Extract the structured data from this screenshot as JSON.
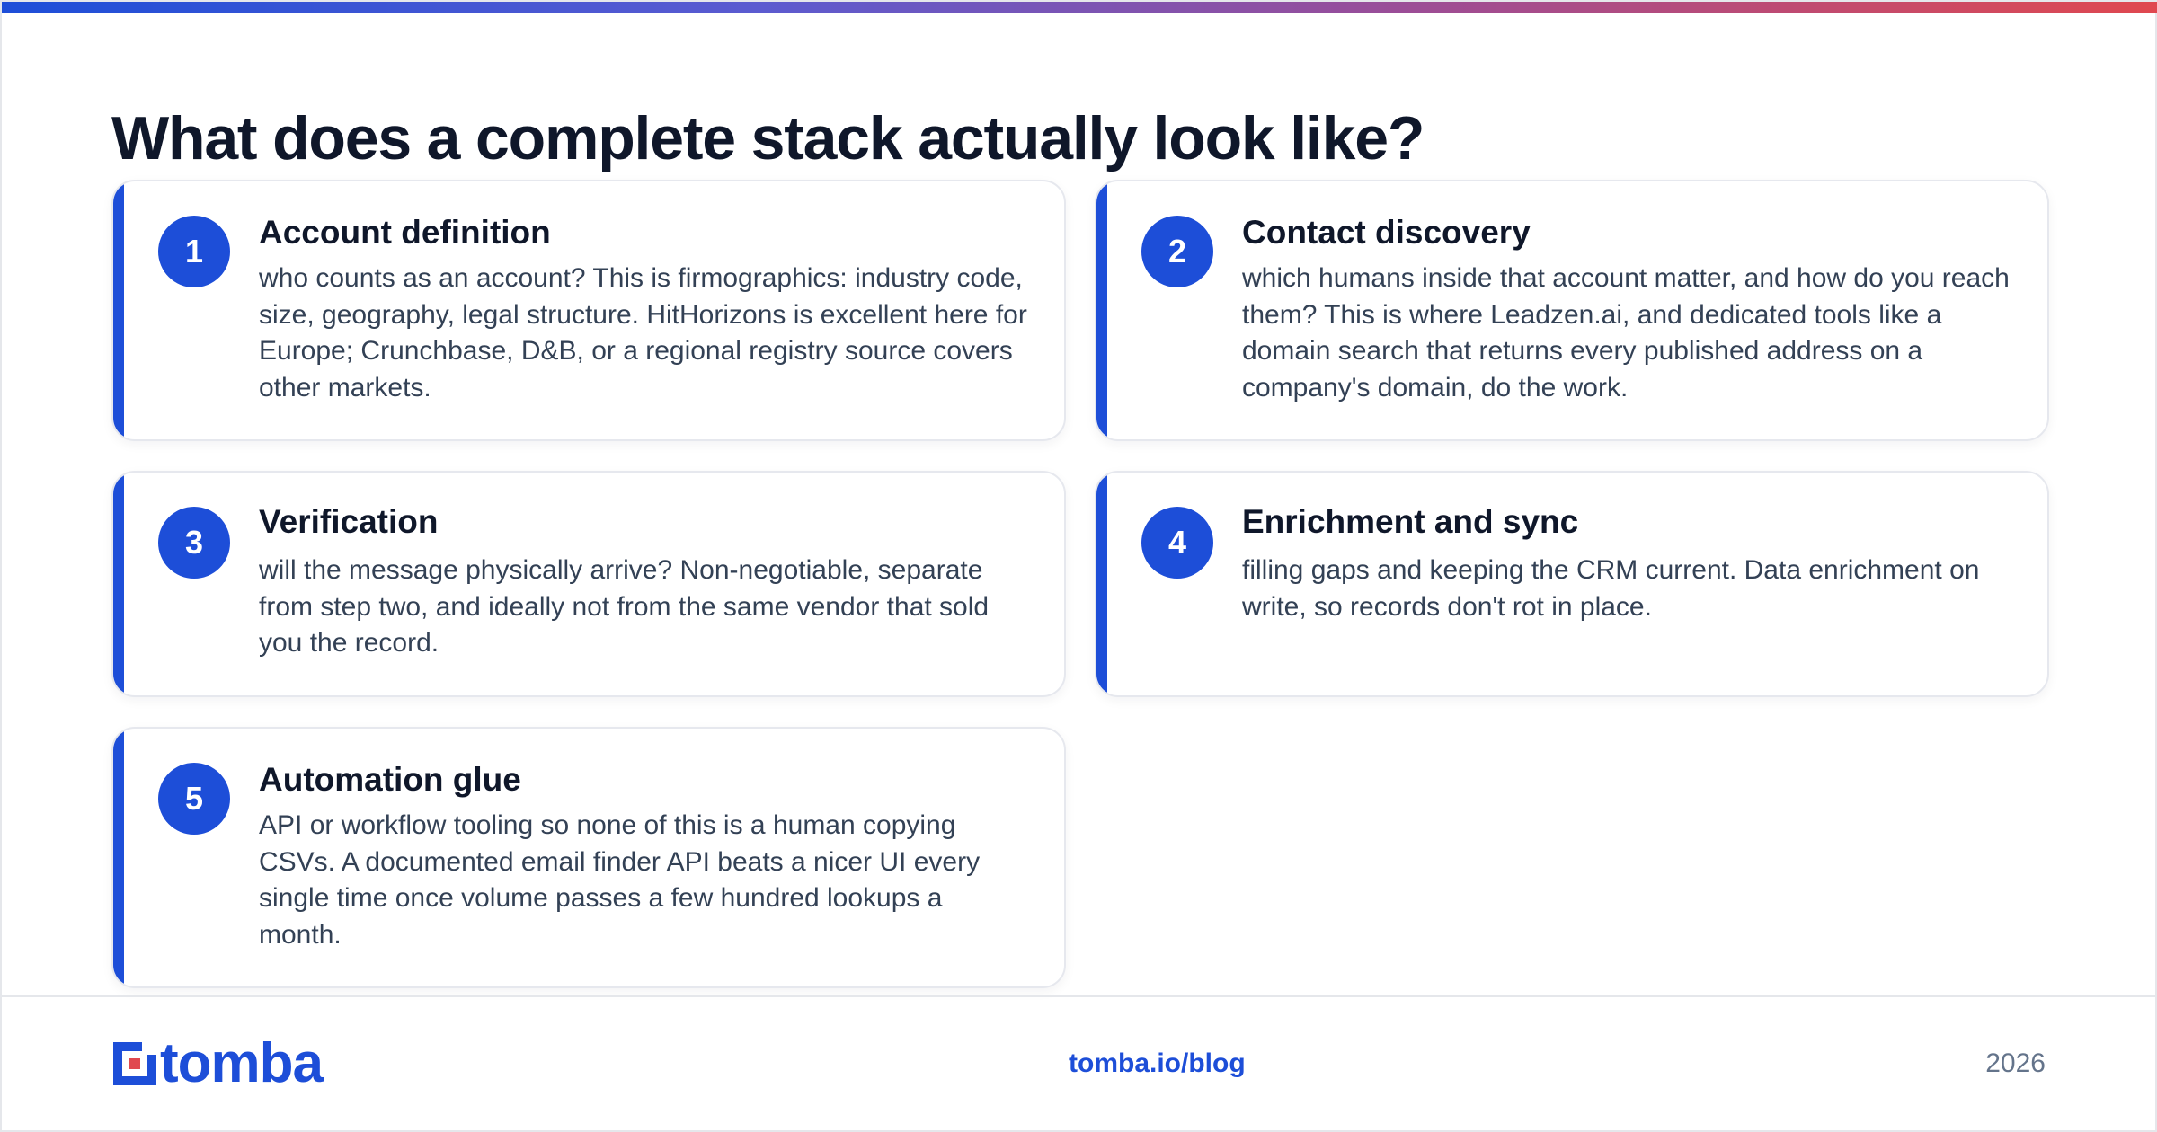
{
  "title": "What does a complete stack actually look like?",
  "cards": [
    {
      "number": "1",
      "title": "Account definition",
      "body": "who counts as an account? This is firmographics: industry code, size, geography, legal structure. HitHorizons is excellent here for Europe; Crunchbase, D&B, or a regional registry source covers other markets."
    },
    {
      "number": "2",
      "title": "Contact discovery",
      "body": "which humans inside that account matter, and how do you reach them? This is where Leadzen.ai, and dedicated tools like a domain search that returns every published address on a company's domain, do the work."
    },
    {
      "number": "3",
      "title": "Verification",
      "body": "will the message physically arrive? Non-negotiable, separate from step two, and ideally not from the same vendor that sold you the record."
    },
    {
      "number": "4",
      "title": "Enrichment and sync",
      "body": "filling gaps and keeping the CRM current. Data enrichment on write, so records don't rot in place."
    },
    {
      "number": "5",
      "title": "Automation glue",
      "body": "API or workflow tooling so none of this is a human copying CSVs. A documented email finder API beats a nicer UI every single time once volume passes a few hundred lookups a month."
    }
  ],
  "footer": {
    "logo_text": "tomba",
    "url": "tomba.io/blog",
    "year": "2026"
  },
  "colors": {
    "accent": "#1d4ed8",
    "title": "#0f172a",
    "body": "#334155",
    "muted": "#64748b"
  }
}
